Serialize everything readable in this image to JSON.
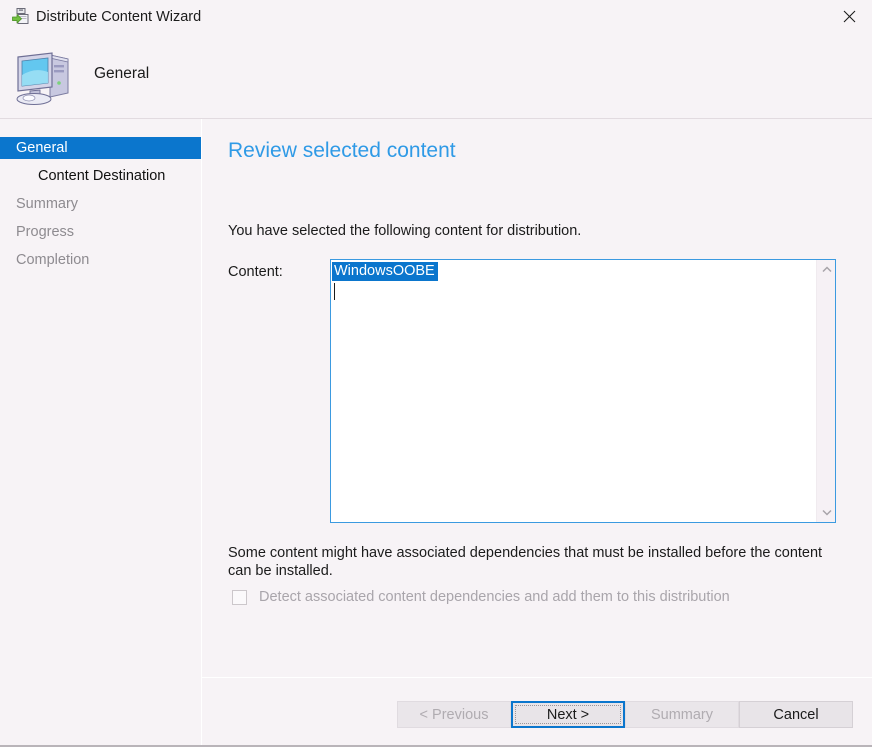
{
  "window": {
    "title": "Distribute Content Wizard",
    "title_icon": "distribute-content-icon",
    "close_label": "✕"
  },
  "header": {
    "icon": "computer-icon",
    "title": "General"
  },
  "sidebar": {
    "items": [
      {
        "label": "General",
        "state": "selected",
        "indent": false
      },
      {
        "label": "Content Destination",
        "state": "active",
        "indent": true
      },
      {
        "label": "Summary",
        "state": "muted",
        "indent": false
      },
      {
        "label": "Progress",
        "state": "muted",
        "indent": false
      },
      {
        "label": "Completion",
        "state": "muted",
        "indent": false
      }
    ]
  },
  "main": {
    "heading": "Review selected content",
    "intro": "You have selected the following content for distribution.",
    "content_label": "Content:",
    "content_list": [
      {
        "name": "WindowsOOBE",
        "selected": true
      }
    ],
    "scrollbar": {
      "up_arrow": "chevron-up-icon",
      "down_arrow": "chevron-down-icon"
    },
    "note": "Some content might have associated dependencies that must be installed before the content can be installed.",
    "dependency_checkbox": {
      "label": "Detect associated content dependencies and add them to this distribution",
      "checked": false,
      "disabled": true
    }
  },
  "buttons": {
    "previous": {
      "label": "< Previous",
      "disabled": true
    },
    "next": {
      "label": "Next >",
      "disabled": false,
      "default": true
    },
    "summary": {
      "label": "Summary",
      "disabled": true
    },
    "cancel": {
      "label": "Cancel",
      "disabled": false
    }
  },
  "colors": {
    "accent_blue": "#0b76cd",
    "heading_blue": "#2f9ae6",
    "window_background": "#f7f3f6",
    "disabled_text": "#a9a5ab"
  }
}
